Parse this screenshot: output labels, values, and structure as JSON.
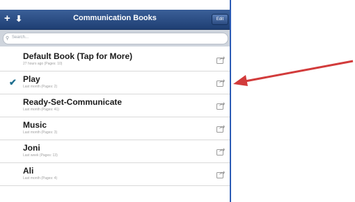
{
  "header": {
    "title": "Communication Books",
    "add_label": "+",
    "download_label": "⬇",
    "edit_label": "Edit"
  },
  "search": {
    "placeholder": "Search..."
  },
  "books": [
    {
      "title": "Default Book (Tap for More)",
      "meta": "27 hours ago (Pages: 10)",
      "checked": false
    },
    {
      "title": "Play",
      "meta": "Last month (Pages: 2)",
      "checked": true
    },
    {
      "title": "Ready-Set-Communicate",
      "meta": "Last month (Pages: 41)",
      "checked": false
    },
    {
      "title": "Music",
      "meta": "Last month (Pages: 3)",
      "checked": false
    },
    {
      "title": "Joni",
      "meta": "Last week (Pages: 13)",
      "checked": false
    },
    {
      "title": "Ali",
      "meta": "Last month (Pages: 4)",
      "checked": false
    }
  ],
  "icons": {
    "check": "checkmark-icon",
    "share": "share-icon",
    "annotation": "red-arrow-icon"
  },
  "colors": {
    "nav": "#2a4c83",
    "check": "#1f6f8f",
    "arrow": "#d23b3b",
    "divider": "#2c5bb5"
  }
}
